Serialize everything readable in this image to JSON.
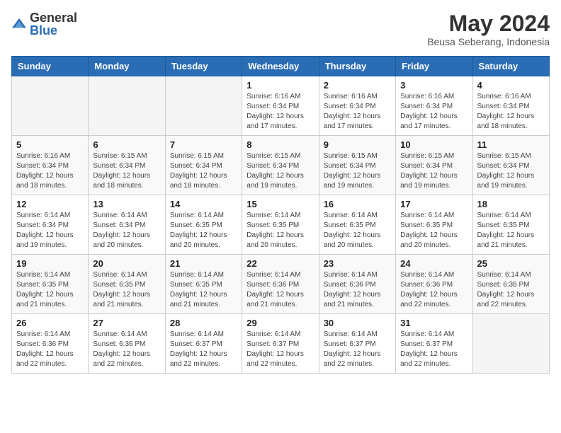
{
  "logo": {
    "text_general": "General",
    "text_blue": "Blue"
  },
  "title": {
    "main": "May 2024",
    "sub": "Beusa Seberang, Indonesia"
  },
  "days_of_week": [
    "Sunday",
    "Monday",
    "Tuesday",
    "Wednesday",
    "Thursday",
    "Friday",
    "Saturday"
  ],
  "weeks": [
    [
      {
        "day": "",
        "info": ""
      },
      {
        "day": "",
        "info": ""
      },
      {
        "day": "",
        "info": ""
      },
      {
        "day": "1",
        "info": "Sunrise: 6:16 AM\nSunset: 6:34 PM\nDaylight: 12 hours and 17 minutes."
      },
      {
        "day": "2",
        "info": "Sunrise: 6:16 AM\nSunset: 6:34 PM\nDaylight: 12 hours and 17 minutes."
      },
      {
        "day": "3",
        "info": "Sunrise: 6:16 AM\nSunset: 6:34 PM\nDaylight: 12 hours and 17 minutes."
      },
      {
        "day": "4",
        "info": "Sunrise: 6:16 AM\nSunset: 6:34 PM\nDaylight: 12 hours and 18 minutes."
      }
    ],
    [
      {
        "day": "5",
        "info": "Sunrise: 6:16 AM\nSunset: 6:34 PM\nDaylight: 12 hours and 18 minutes."
      },
      {
        "day": "6",
        "info": "Sunrise: 6:15 AM\nSunset: 6:34 PM\nDaylight: 12 hours and 18 minutes."
      },
      {
        "day": "7",
        "info": "Sunrise: 6:15 AM\nSunset: 6:34 PM\nDaylight: 12 hours and 18 minutes."
      },
      {
        "day": "8",
        "info": "Sunrise: 6:15 AM\nSunset: 6:34 PM\nDaylight: 12 hours and 19 minutes."
      },
      {
        "day": "9",
        "info": "Sunrise: 6:15 AM\nSunset: 6:34 PM\nDaylight: 12 hours and 19 minutes."
      },
      {
        "day": "10",
        "info": "Sunrise: 6:15 AM\nSunset: 6:34 PM\nDaylight: 12 hours and 19 minutes."
      },
      {
        "day": "11",
        "info": "Sunrise: 6:15 AM\nSunset: 6:34 PM\nDaylight: 12 hours and 19 minutes."
      }
    ],
    [
      {
        "day": "12",
        "info": "Sunrise: 6:14 AM\nSunset: 6:34 PM\nDaylight: 12 hours and 19 minutes."
      },
      {
        "day": "13",
        "info": "Sunrise: 6:14 AM\nSunset: 6:34 PM\nDaylight: 12 hours and 20 minutes."
      },
      {
        "day": "14",
        "info": "Sunrise: 6:14 AM\nSunset: 6:35 PM\nDaylight: 12 hours and 20 minutes."
      },
      {
        "day": "15",
        "info": "Sunrise: 6:14 AM\nSunset: 6:35 PM\nDaylight: 12 hours and 20 minutes."
      },
      {
        "day": "16",
        "info": "Sunrise: 6:14 AM\nSunset: 6:35 PM\nDaylight: 12 hours and 20 minutes."
      },
      {
        "day": "17",
        "info": "Sunrise: 6:14 AM\nSunset: 6:35 PM\nDaylight: 12 hours and 20 minutes."
      },
      {
        "day": "18",
        "info": "Sunrise: 6:14 AM\nSunset: 6:35 PM\nDaylight: 12 hours and 21 minutes."
      }
    ],
    [
      {
        "day": "19",
        "info": "Sunrise: 6:14 AM\nSunset: 6:35 PM\nDaylight: 12 hours and 21 minutes."
      },
      {
        "day": "20",
        "info": "Sunrise: 6:14 AM\nSunset: 6:35 PM\nDaylight: 12 hours and 21 minutes."
      },
      {
        "day": "21",
        "info": "Sunrise: 6:14 AM\nSunset: 6:35 PM\nDaylight: 12 hours and 21 minutes."
      },
      {
        "day": "22",
        "info": "Sunrise: 6:14 AM\nSunset: 6:36 PM\nDaylight: 12 hours and 21 minutes."
      },
      {
        "day": "23",
        "info": "Sunrise: 6:14 AM\nSunset: 6:36 PM\nDaylight: 12 hours and 21 minutes."
      },
      {
        "day": "24",
        "info": "Sunrise: 6:14 AM\nSunset: 6:36 PM\nDaylight: 12 hours and 22 minutes."
      },
      {
        "day": "25",
        "info": "Sunrise: 6:14 AM\nSunset: 6:36 PM\nDaylight: 12 hours and 22 minutes."
      }
    ],
    [
      {
        "day": "26",
        "info": "Sunrise: 6:14 AM\nSunset: 6:36 PM\nDaylight: 12 hours and 22 minutes."
      },
      {
        "day": "27",
        "info": "Sunrise: 6:14 AM\nSunset: 6:36 PM\nDaylight: 12 hours and 22 minutes."
      },
      {
        "day": "28",
        "info": "Sunrise: 6:14 AM\nSunset: 6:37 PM\nDaylight: 12 hours and 22 minutes."
      },
      {
        "day": "29",
        "info": "Sunrise: 6:14 AM\nSunset: 6:37 PM\nDaylight: 12 hours and 22 minutes."
      },
      {
        "day": "30",
        "info": "Sunrise: 6:14 AM\nSunset: 6:37 PM\nDaylight: 12 hours and 22 minutes."
      },
      {
        "day": "31",
        "info": "Sunrise: 6:14 AM\nSunset: 6:37 PM\nDaylight: 12 hours and 22 minutes."
      },
      {
        "day": "",
        "info": ""
      }
    ]
  ]
}
